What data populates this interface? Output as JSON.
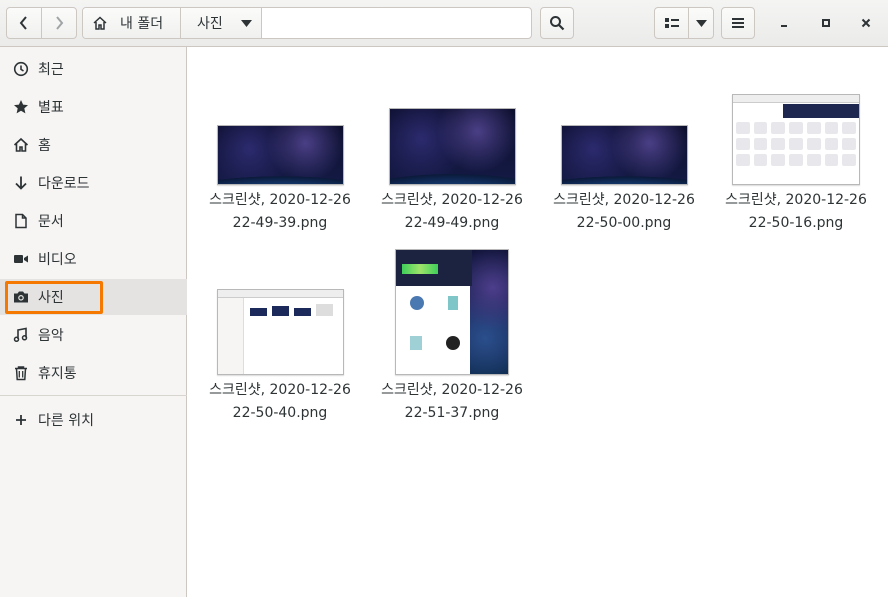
{
  "header": {
    "path": {
      "home_label": "내 폴더",
      "current_label": "사진"
    }
  },
  "sidebar": {
    "items": [
      {
        "label": "최근",
        "icon": "clock-icon"
      },
      {
        "label": "별표",
        "icon": "star-icon"
      },
      {
        "label": "홈",
        "icon": "home-icon"
      },
      {
        "label": "다운로드",
        "icon": "download-icon"
      },
      {
        "label": "문서",
        "icon": "document-icon"
      },
      {
        "label": "비디오",
        "icon": "video-icon"
      },
      {
        "label": "사진",
        "icon": "camera-icon",
        "active": true
      },
      {
        "label": "음악",
        "icon": "music-icon"
      },
      {
        "label": "휴지통",
        "icon": "trash-icon"
      }
    ],
    "other_locations": {
      "label": "다른 위치",
      "icon": "plus-icon"
    }
  },
  "files": [
    {
      "line1": "스크린샷, 2020-12-26",
      "line2": "22-49-39.png"
    },
    {
      "line1": "스크린샷, 2020-12-26",
      "line2": "22-49-49.png"
    },
    {
      "line1": "스크린샷, 2020-12-26",
      "line2": "22-50-00.png"
    },
    {
      "line1": "스크린샷, 2020-12-26",
      "line2": "22-50-16.png"
    },
    {
      "line1": "스크린샷, 2020-12-26",
      "line2": "22-50-40.png"
    },
    {
      "line1": "스크린샷, 2020-12-26",
      "line2": "22-51-37.png"
    }
  ],
  "colors": {
    "accent_highlight": "#f57900",
    "sidebar_bg": "#f6f5f4"
  }
}
